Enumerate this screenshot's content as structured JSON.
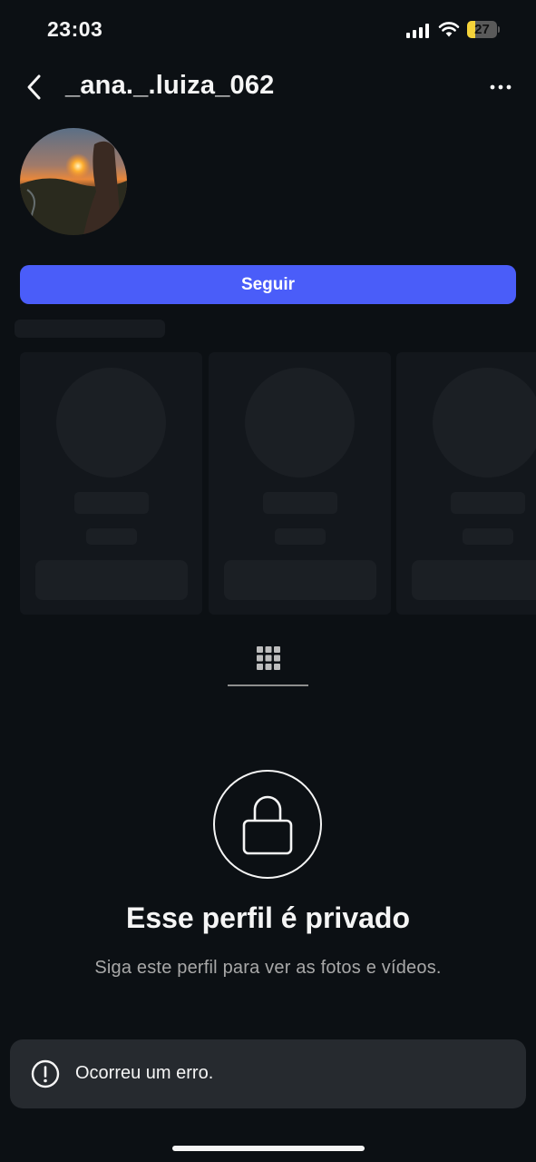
{
  "status_bar": {
    "time": "23:03",
    "battery_level": "27",
    "battery_fraction": 0.27,
    "icons": [
      "signal-icon",
      "wifi-icon",
      "battery-icon"
    ]
  },
  "header": {
    "username": "_ana._.luiza_062",
    "back_icon": "chevron-left-icon",
    "more_icon": "more-horizontal-icon"
  },
  "profile": {
    "follow_label": "Seguir"
  },
  "suggestions": {
    "card_count": 3
  },
  "tabs": {
    "active": "grid-icon"
  },
  "private_notice": {
    "icon": "lock-icon",
    "title": "Esse perfil é privado",
    "subtitle": "Siga este perfil para ver as fotos e vídeos."
  },
  "toast": {
    "icon": "alert-circle-icon",
    "message": "Ocorreu um erro."
  },
  "colors": {
    "background": "#0c1014",
    "follow_button": "#4a5df9",
    "battery_fill": "#f5d33a",
    "toast_background": "#262a2f",
    "secondary_text": "#a8a8a8"
  }
}
